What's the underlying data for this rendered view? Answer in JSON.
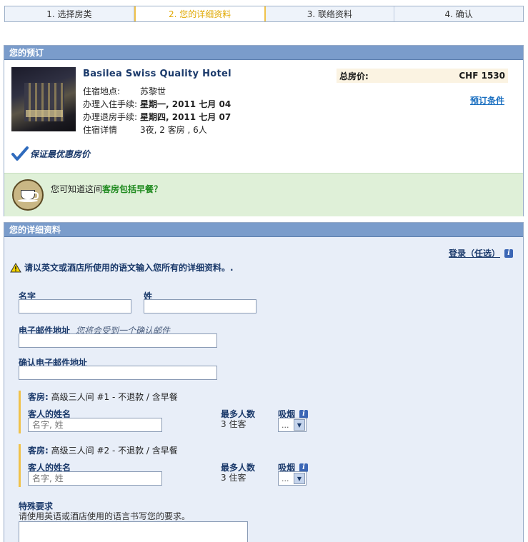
{
  "steps": [
    {
      "label": "1. 选择房类"
    },
    {
      "label": "2. 您的详细资料"
    },
    {
      "label": "3. 联络资料"
    },
    {
      "label": "4. 确认"
    }
  ],
  "booking": {
    "header": "您的预订",
    "hotel_name": "Basilea Swiss Quality Hotel",
    "location_label": "住宿地点:",
    "location_value": "苏黎世",
    "checkin_label": "办理入住手续:",
    "checkin_value": "星期一, 2011 七月 04",
    "checkout_label": "办理退房手续:",
    "checkout_value": "星期四, 2011 七月 07",
    "stay_label": "住宿详情",
    "stay_value": "3夜, 2 客房 , 6人",
    "total_label": "总房价:",
    "total_value": "CHF 1530",
    "terms_link": "预订条件",
    "guarantee": "保证最优惠房价",
    "breakfast_prefix": "您可知道这间",
    "breakfast_highlight": "客房包括早餐？"
  },
  "details": {
    "header": "您的详细资料",
    "login_link": "登录（任选）",
    "warning": "请以英文或酒店所使用的语文输入您所有的详细资料。.",
    "first_name_label": "名字",
    "last_name_label": "姓",
    "email_label": "电子邮件地址",
    "email_hint": "您将会受到一个确认邮件",
    "confirm_email_label": "确认电子邮件地址",
    "rooms": [
      {
        "title_label": "客房:",
        "title_value": "高级三人间 #1 - 不退款 / 含早餐",
        "guest_label": "客人的姓名",
        "guest_placeholder": "名字, 姓",
        "max_label": "最多人数",
        "max_value": "3 住客",
        "smoking_label": "吸烟",
        "smoking_value": "..."
      },
      {
        "title_label": "客房:",
        "title_value": "高级三人间 #2 - 不退款 / 含早餐",
        "guest_label": "客人的姓名",
        "guest_placeholder": "名字, 姓",
        "max_label": "最多人数",
        "max_value": "3 住客",
        "smoking_label": "吸烟",
        "smoking_value": "..."
      }
    ],
    "special_label": "特殊要求",
    "special_hint": "请使用英语或酒店使用的语言书写您的要求。"
  }
}
